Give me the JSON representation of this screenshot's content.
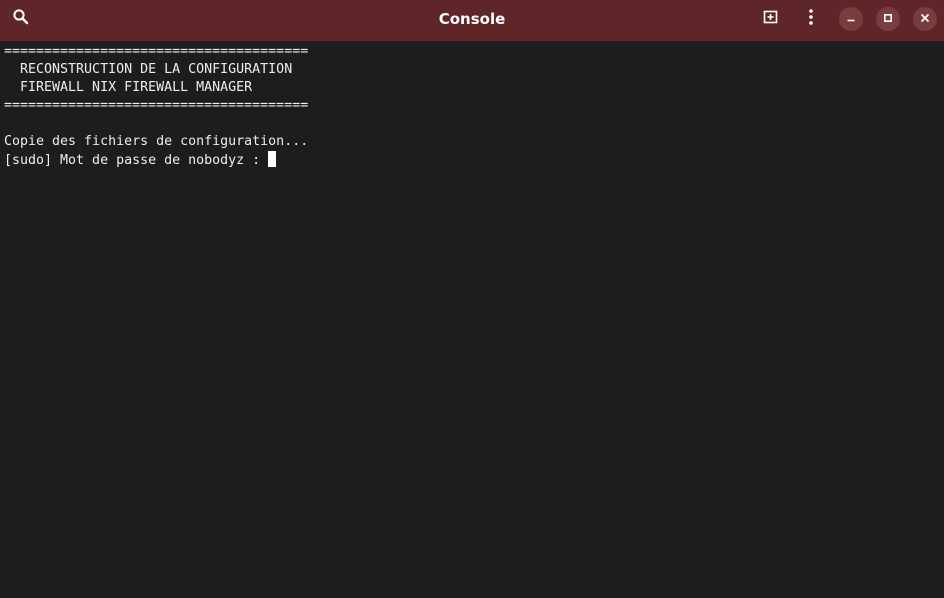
{
  "window": {
    "title": "Console",
    "titlebar_color": "#5e2628",
    "background_color": "#1d1d20",
    "text_color": "#ededed"
  },
  "toolbar": {
    "search_icon": "search-icon",
    "new_tab_icon": "new-tab-icon",
    "menu_icon": "kebab-menu-icon",
    "minimize_icon": "minimize-icon",
    "maximize_icon": "maximize-icon",
    "close_icon": "close-icon"
  },
  "terminal": {
    "lines": [
      "======================================",
      "  RECONSTRUCTION DE LA CONFIGURATION",
      "  FIREWALL NIX FIREWALL MANAGER",
      "======================================",
      "",
      "Copie des fichiers de configuration...",
      "[sudo] Mot de passe de nobodyz : "
    ]
  }
}
